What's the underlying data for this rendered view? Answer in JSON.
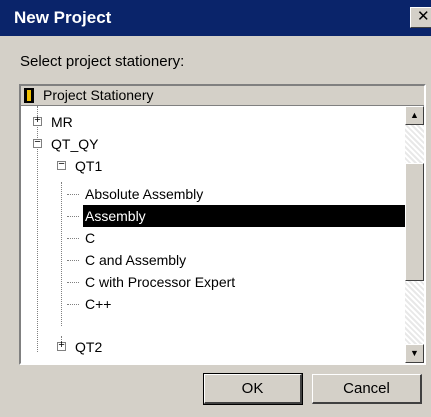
{
  "window": {
    "title": "New Project",
    "close_glyph": "✕"
  },
  "prompt": "Select project stationery:",
  "tree": {
    "header_label": "Project Stationery",
    "header_icon": "stationery-icon",
    "nodes": {
      "mr": "MR",
      "qt_qy": "QT_QY",
      "qt1": "QT1",
      "absolute_assembly": "Absolute Assembly",
      "assembly": "Assembly",
      "c": "C",
      "c_and_assembly": "C and  Assembly",
      "c_with_pe": "C with Processor Expert",
      "cpp": "C++",
      "qt2": "QT2"
    },
    "selected": "Assembly",
    "glyphs": {
      "plus": "+",
      "minus": "−",
      "up": "▲",
      "down": "▼"
    }
  },
  "buttons": {
    "ok": "OK",
    "cancel": "Cancel"
  }
}
